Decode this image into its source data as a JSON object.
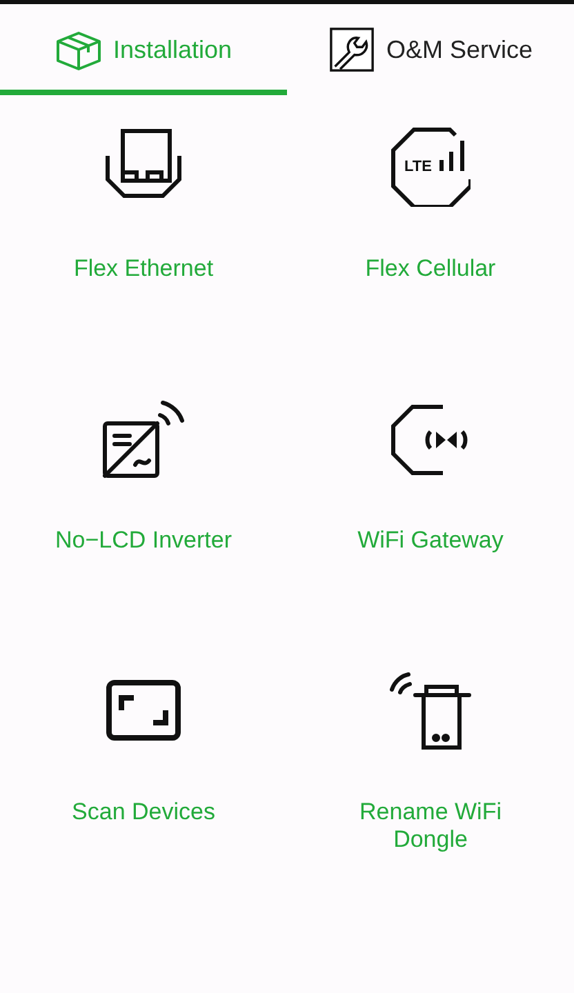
{
  "tabs": [
    {
      "label": "Installation",
      "kind": "box",
      "selected": true
    },
    {
      "label": "O&M Service",
      "kind": "wrench",
      "selected": false
    }
  ],
  "cellular_icon_text": "LTE",
  "items": [
    {
      "label": "Flex Ethernet",
      "kind": "ethernet"
    },
    {
      "label": "Flex Cellular",
      "kind": "cellular"
    },
    {
      "label": "No−LCD Inverter",
      "kind": "inverter"
    },
    {
      "label": "WiFi Gateway",
      "kind": "gateway"
    },
    {
      "label": "Scan Devices",
      "kind": "scan"
    },
    {
      "label": "Rename WiFi Dongle",
      "kind": "dongle"
    }
  ]
}
